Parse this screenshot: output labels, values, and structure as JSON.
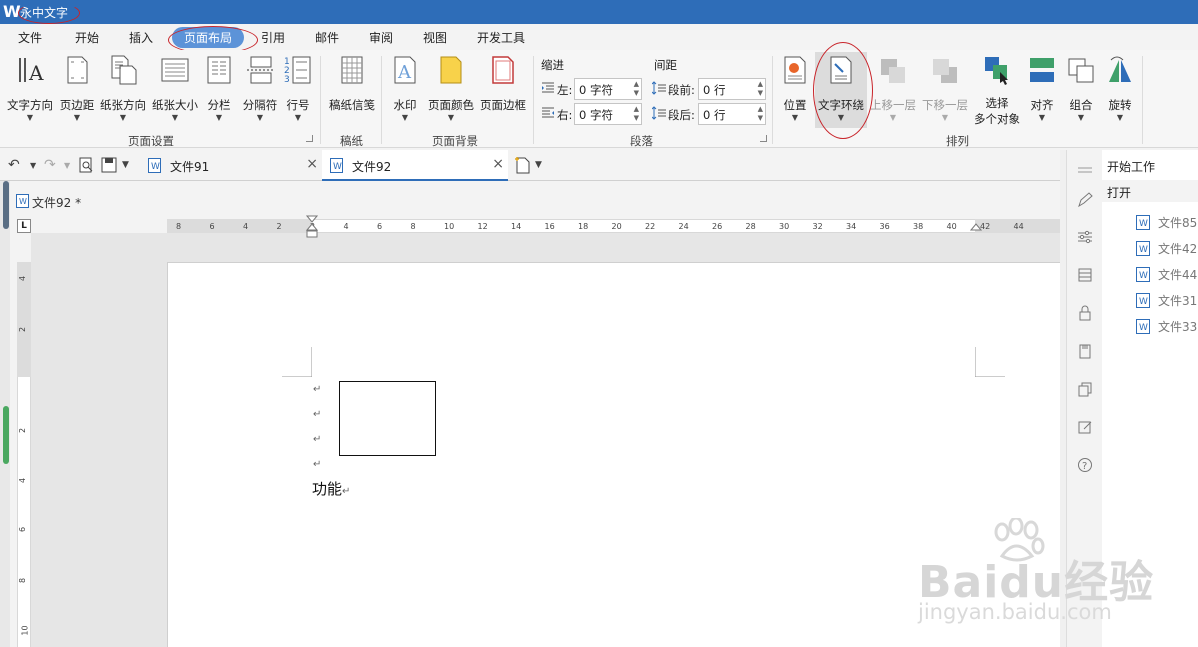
{
  "titlebar": {
    "logo_glyph": "W",
    "title": "永中文字"
  },
  "menu": [
    {
      "label": "文件"
    },
    {
      "label": "开始"
    },
    {
      "label": "插入"
    },
    {
      "label": "页面布局"
    },
    {
      "label": "引用"
    },
    {
      "label": "邮件"
    },
    {
      "label": "审阅"
    },
    {
      "label": "视图"
    },
    {
      "label": "开发工具"
    }
  ],
  "ribbon": {
    "page_setup": {
      "group_label": "页面设置",
      "buttons": [
        "文字方向",
        "页边距",
        "纸张方向",
        "纸张大小",
        "分栏",
        "分隔符",
        "行号"
      ]
    },
    "manuscript": {
      "group_label": "稿纸",
      "buttons": [
        "稿纸信笺"
      ]
    },
    "page_bg": {
      "group_label": "页面背景",
      "buttons": [
        "水印",
        "页面颜色",
        "页面边框"
      ]
    },
    "paragraph": {
      "group_label": "段落",
      "indent_title": "缩进",
      "spacing_title": "间距",
      "indent_left_label": "左:",
      "indent_left_value": "0 字符",
      "indent_right_label": "右:",
      "indent_right_value": "0 字符",
      "space_before_label": "段前:",
      "space_before_value": "0 行",
      "space_after_label": "段后:",
      "space_after_value": "0 行"
    },
    "arrange": {
      "group_label": "排列",
      "position": "位置",
      "wrap": "文字环绕",
      "bring_forward": "上移一层",
      "send_backward": "下移一层",
      "select_line1": "选择",
      "select_line2": "多个对象",
      "align": "对齐",
      "group": "组合",
      "rotate": "旋转"
    }
  },
  "tabs": [
    {
      "label": "文件91",
      "active": false
    },
    {
      "label": "文件92",
      "active": true
    }
  ],
  "doc_path": "文件92 *",
  "ruler": {
    "corner": "L",
    "h_ticks": [
      "8",
      "6",
      "4",
      "2",
      "2",
      "4",
      "6",
      "8",
      "10",
      "12",
      "14",
      "16",
      "18",
      "20",
      "22",
      "24",
      "26",
      "28",
      "30",
      "32",
      "34",
      "36",
      "38",
      "40",
      "42",
      "44"
    ],
    "v_ticks": [
      "4",
      "2",
      "2",
      "4",
      "6",
      "8",
      "10"
    ]
  },
  "document": {
    "para_mark": "↵",
    "body_text": "功能",
    "body_mark": "↵"
  },
  "side_panel": {
    "start_work": "开始工作",
    "open": "打开",
    "recent": [
      "文件85",
      "文件42",
      "文件44",
      "文件31",
      "文件33"
    ]
  },
  "watermark": {
    "brand": "Baidu经验",
    "url": "jingyan.baidu.com"
  },
  "colors": {
    "title_bar": "#2e6db8",
    "accent_tab": "#5c93d8",
    "annotation": "#c8242a"
  }
}
